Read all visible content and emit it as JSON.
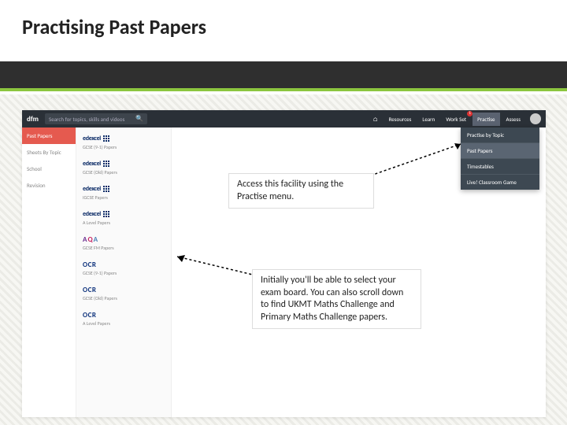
{
  "slide": {
    "title": "Practising Past Papers"
  },
  "topbar": {
    "logo": "dfm",
    "search_placeholder": "Search for topics, skills and videos",
    "nav": {
      "home": "⌂",
      "resources": "Resources",
      "learn": "Learn",
      "workset": "Work Set",
      "practise": "Practise",
      "assess": "Assess"
    }
  },
  "dropdown": {
    "items": [
      "Practise by Topic",
      "Past Papers",
      "Timestables",
      "Live! Classroom Game"
    ]
  },
  "leftnav": {
    "items": [
      "Past Papers",
      "Sheets By Topic",
      "School",
      "Revision"
    ]
  },
  "boards": [
    {
      "logo": "edexcel",
      "label": "GCSE (9-1) Papers"
    },
    {
      "logo": "edexcel",
      "label": "GCSE (Old) Papers"
    },
    {
      "logo": "edexcel",
      "label": "IGCSE Papers"
    },
    {
      "logo": "edexcel",
      "label": "A Level Papers"
    },
    {
      "logo": "aqa",
      "label": "GCSE FM Papers"
    },
    {
      "logo": "ocr",
      "label": "GCSE (9-1) Papers"
    },
    {
      "logo": "ocr",
      "label": "GCSE (Old) Papers"
    },
    {
      "logo": "ocr",
      "label": "A Level Papers"
    }
  ],
  "callouts": {
    "c1": "Access this facility using the Practise menu.",
    "c2": "Initially you'll be able to select your exam board. You can also scroll down to find UKMT Maths Challenge and Primary Maths Challenge papers."
  }
}
